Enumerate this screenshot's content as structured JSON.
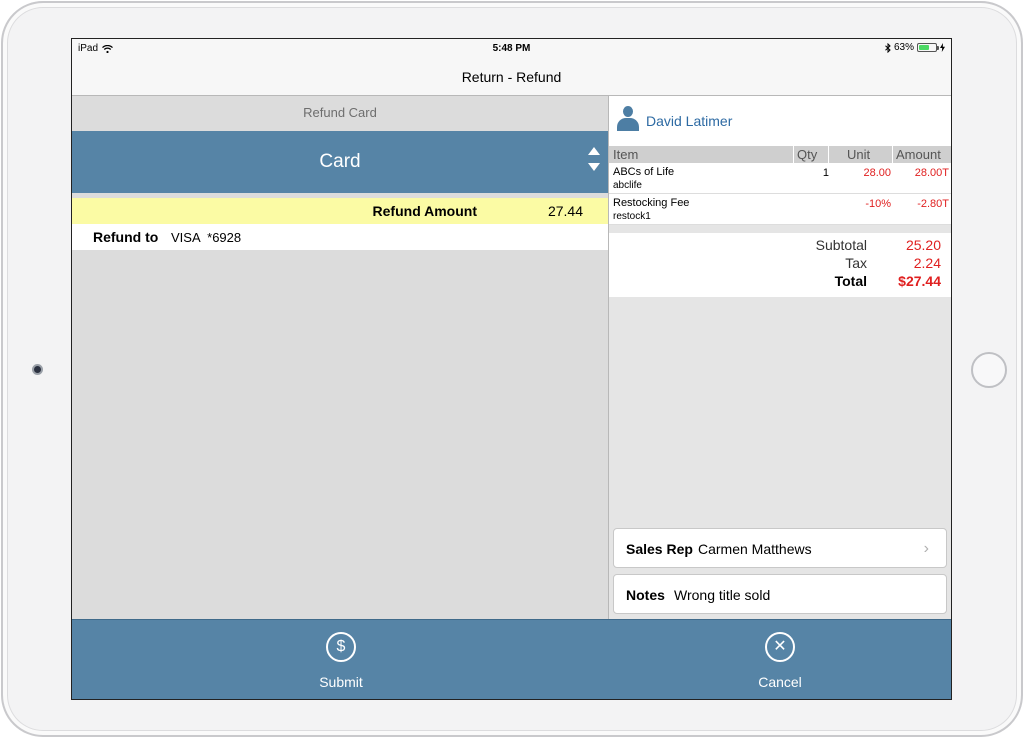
{
  "status_bar": {
    "carrier": "iPad",
    "time": "5:48 PM",
    "battery": "63%",
    "battery_level": 0.63
  },
  "nav": {
    "title": "Return - Refund"
  },
  "left": {
    "section_title": "Refund Card",
    "selector_label": "Card",
    "refund_amount_label": "Refund Amount",
    "refund_amount_value": "27.44",
    "refund_to_label": "Refund to",
    "refund_to_value": "VISA  *6928"
  },
  "right": {
    "customer_name": "David Latimer",
    "columns": [
      "Item",
      "Qty",
      "Unit",
      "Amount"
    ],
    "items": [
      {
        "name": "ABCs of Life",
        "sku": "abclife",
        "qty": "1",
        "unit": "28.00",
        "amount": "28.00T"
      },
      {
        "name": "Restocking Fee",
        "sku": "restock1",
        "qty": "",
        "unit": "-10%",
        "amount": "-2.80T"
      }
    ],
    "totals": {
      "subtotal_label": "Subtotal",
      "subtotal_value": "25.20",
      "tax_label": "Tax",
      "tax_value": "2.24",
      "total_label": "Total",
      "total_value": "$27.44"
    },
    "sales_rep_label": "Sales Rep",
    "sales_rep_value": "Carmen Matthews",
    "notes_label": "Notes",
    "notes_value": "Wrong title sold"
  },
  "toolbar": {
    "submit_label": "Submit",
    "cancel_label": "Cancel"
  },
  "colors": {
    "accent": "#5684a6",
    "highlight": "#fbfba4",
    "negative": "#e02020",
    "link": "#2d6aa3"
  },
  "icons": [
    "wifi-icon",
    "bluetooth-icon",
    "battery-icon",
    "person-icon",
    "dollar-icon",
    "close-icon",
    "chevron-right-icon"
  ]
}
